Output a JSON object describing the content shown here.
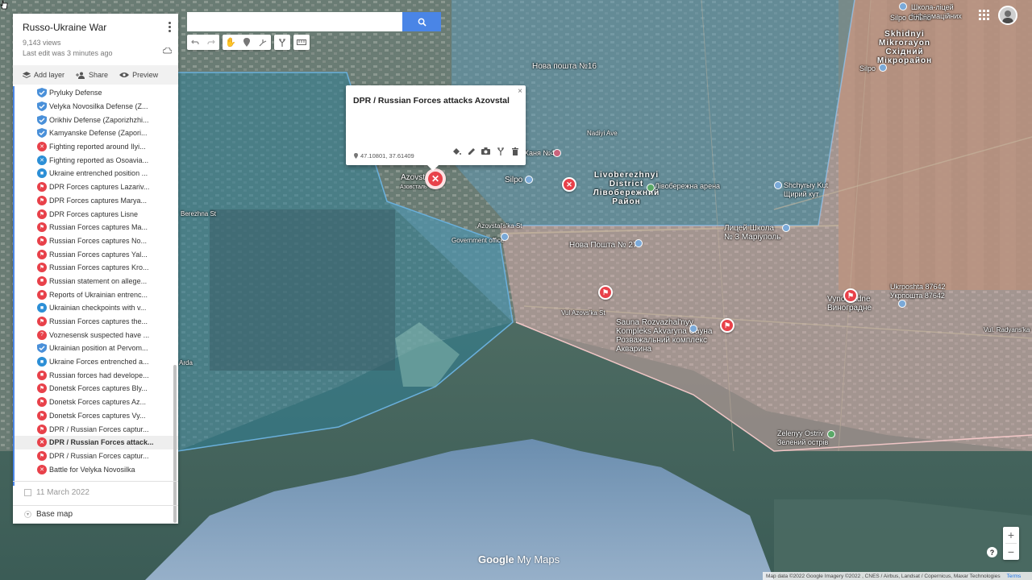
{
  "panel": {
    "title": "Russo-Ukraine War",
    "views": "9,143 views",
    "last_edit": "Last edit was 3 minutes ago",
    "actions": {
      "add_layer": "Add layer",
      "share": "Share",
      "preview": "Preview"
    },
    "items": [
      {
        "label": "Pryluky Defense",
        "icon": "shield-icon"
      },
      {
        "label": "Velyka Novosilka Defense (Z...",
        "icon": "shield-icon"
      },
      {
        "label": "Orikhiv Defense (Zaporizhzhi...",
        "icon": "shield-icon"
      },
      {
        "label": "Kamyanske Defense (Zapori...",
        "icon": "shield-icon"
      },
      {
        "label": "Fighting reported around Ilyi...",
        "icon": "swords-icon"
      },
      {
        "label": "Fighting reported as Osoavia...",
        "icon": "swords-blue-icon"
      },
      {
        "label": "Ukraine entrenched position ...",
        "icon": "fort-icon"
      },
      {
        "label": "DPR Forces captures Lazariv...",
        "icon": "flag-icon"
      },
      {
        "label": "DPR Forces captures Marya...",
        "icon": "flag-icon"
      },
      {
        "label": "DPR Forces captures Lisne",
        "icon": "flag-icon"
      },
      {
        "label": "Russian Forces captures Ma...",
        "icon": "flag-icon"
      },
      {
        "label": "Russian Forces captures No...",
        "icon": "flag-icon"
      },
      {
        "label": "Russian Forces captures Yal...",
        "icon": "flag-icon"
      },
      {
        "label": "Russian Forces captures Kro...",
        "icon": "flag-icon"
      },
      {
        "label": "Russian statement on allege...",
        "icon": "fort-red-icon"
      },
      {
        "label": "Reports of Ukrainian entrenc...",
        "icon": "fort-red-icon"
      },
      {
        "label": "Ukrainian checkpoints with v...",
        "icon": "fort-icon"
      },
      {
        "label": "Russian Forces captures the...",
        "icon": "flag-icon"
      },
      {
        "label": "Voznesensk suspected have ...",
        "icon": "question-icon"
      },
      {
        "label": "Ukrainian position at Pervom...",
        "icon": "shield-icon"
      },
      {
        "label": "Ukraine Forces entrenched a...",
        "icon": "fort-icon"
      },
      {
        "label": "Russian forces had develope...",
        "icon": "fort-red-icon"
      },
      {
        "label": "Donetsk Forces captures Bly...",
        "icon": "flag-icon"
      },
      {
        "label": "Donetsk Forces captures Az...",
        "icon": "flag-icon"
      },
      {
        "label": "Donetsk Forces captures Vy...",
        "icon": "flag-icon"
      },
      {
        "label": "DPR / Russian Forces captur...",
        "icon": "flag-icon"
      },
      {
        "label": "DPR / Russian Forces attack...",
        "icon": "swords-icon",
        "active": true
      },
      {
        "label": "DPR / Russian Forces captur...",
        "icon": "flag-icon"
      },
      {
        "label": "Battle for Velyka Novosilka",
        "icon": "swords-icon"
      }
    ],
    "date_layer": "11 March 2022",
    "base_map": "Base map"
  },
  "popup": {
    "title": "DPR / Russian Forces attacks Azovstal",
    "coords": "47.10801, 37.61409",
    "close": "×"
  },
  "map_labels": {
    "l1": "Нова пошта №16",
    "l2": "Livoberezhnyi District Лівобережний Район",
    "l3": "Azovst",
    "l4": "Silpo",
    "l5": "Government office",
    "l6": "Нова Пошта № 27",
    "l7": "Лицей Школа № 3 Маріуполь",
    "l8": "Shchyrыy Kut Щирий кут",
    "l9": "Sauna Rozvazhal'nyy Kompleks Akvaryna Сауна Розважальний комплекс Акварина",
    "l10": "Vynohradne Виноградне",
    "l11": "Ukrposhta 87642 Укрпошта 87642",
    "l12": "Zelenyy Ostriv Зелений острів",
    "l13": "Skhidnyi Mikrorayon Східний Мікрорайон",
    "l14": "Школа-ліцей Інформаційних",
    "l15": "Азовсталь",
    "l16": "Лівобережна арена",
    "l17": "Berezhna St",
    "l18": "Azovstal's'ka St",
    "l19": "Vul. Radyans'ka",
    "l20": "Silpo Сільпо",
    "l21": "Silpo",
    "l22": "Ханя №4",
    "l23": "Аrda",
    "l24": "Nadiyi Ave",
    "l25": "Vul Azovs'ka St"
  },
  "attribution": {
    "text": "Map data ©2022 Google Imagery ©2022 , CNES / Airbus, Landsat / Copernicus, Maxar Technologies",
    "terms": "Terms"
  },
  "logo": {
    "google": "Google",
    "rest": " My Maps"
  },
  "zoom": {
    "in": "+",
    "out": "−"
  },
  "help": "?",
  "colors": {
    "accent": "#4a85e6",
    "marker_red": "#e8414a",
    "ukraine_zone": "#6ea8c8",
    "russia_zone": "#e8b3b3"
  }
}
